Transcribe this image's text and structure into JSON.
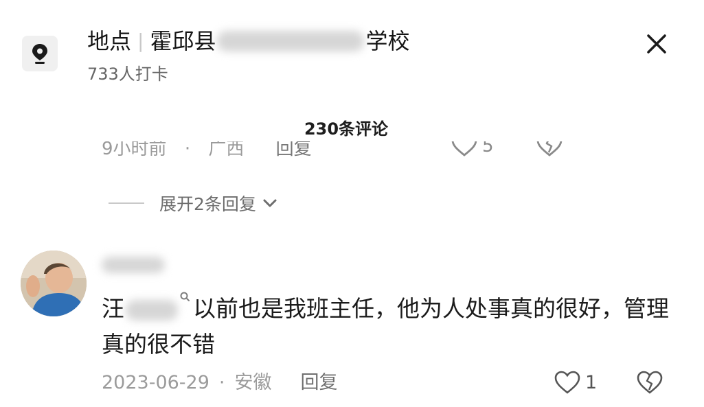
{
  "header": {
    "location_label": "地点",
    "location_name_prefix": "霍邱县",
    "location_name_suffix": "学校",
    "checkins": "733人打卡",
    "icons": {
      "location": "location-pin-icon",
      "close": "close-icon"
    }
  },
  "comments_count": "230条评论",
  "previous_comment": {
    "time_partial": "9小时前",
    "region_partial": "广西",
    "reply_label": "回复",
    "like_count": "5"
  },
  "expand_replies": "展开2条回复",
  "comment": {
    "text_before_mention": "汪",
    "text_after_mention": "以前也是我班主任，他为人处事真的很好，管理真的很不错",
    "date": "2023-06-29",
    "region": "安徽",
    "reply_label": "回复",
    "like_count": "1"
  },
  "separator": "·",
  "colors": {
    "text": "#1b1b1b",
    "muted": "#9b9b9b",
    "icon_bg": "#f0f0f0"
  }
}
